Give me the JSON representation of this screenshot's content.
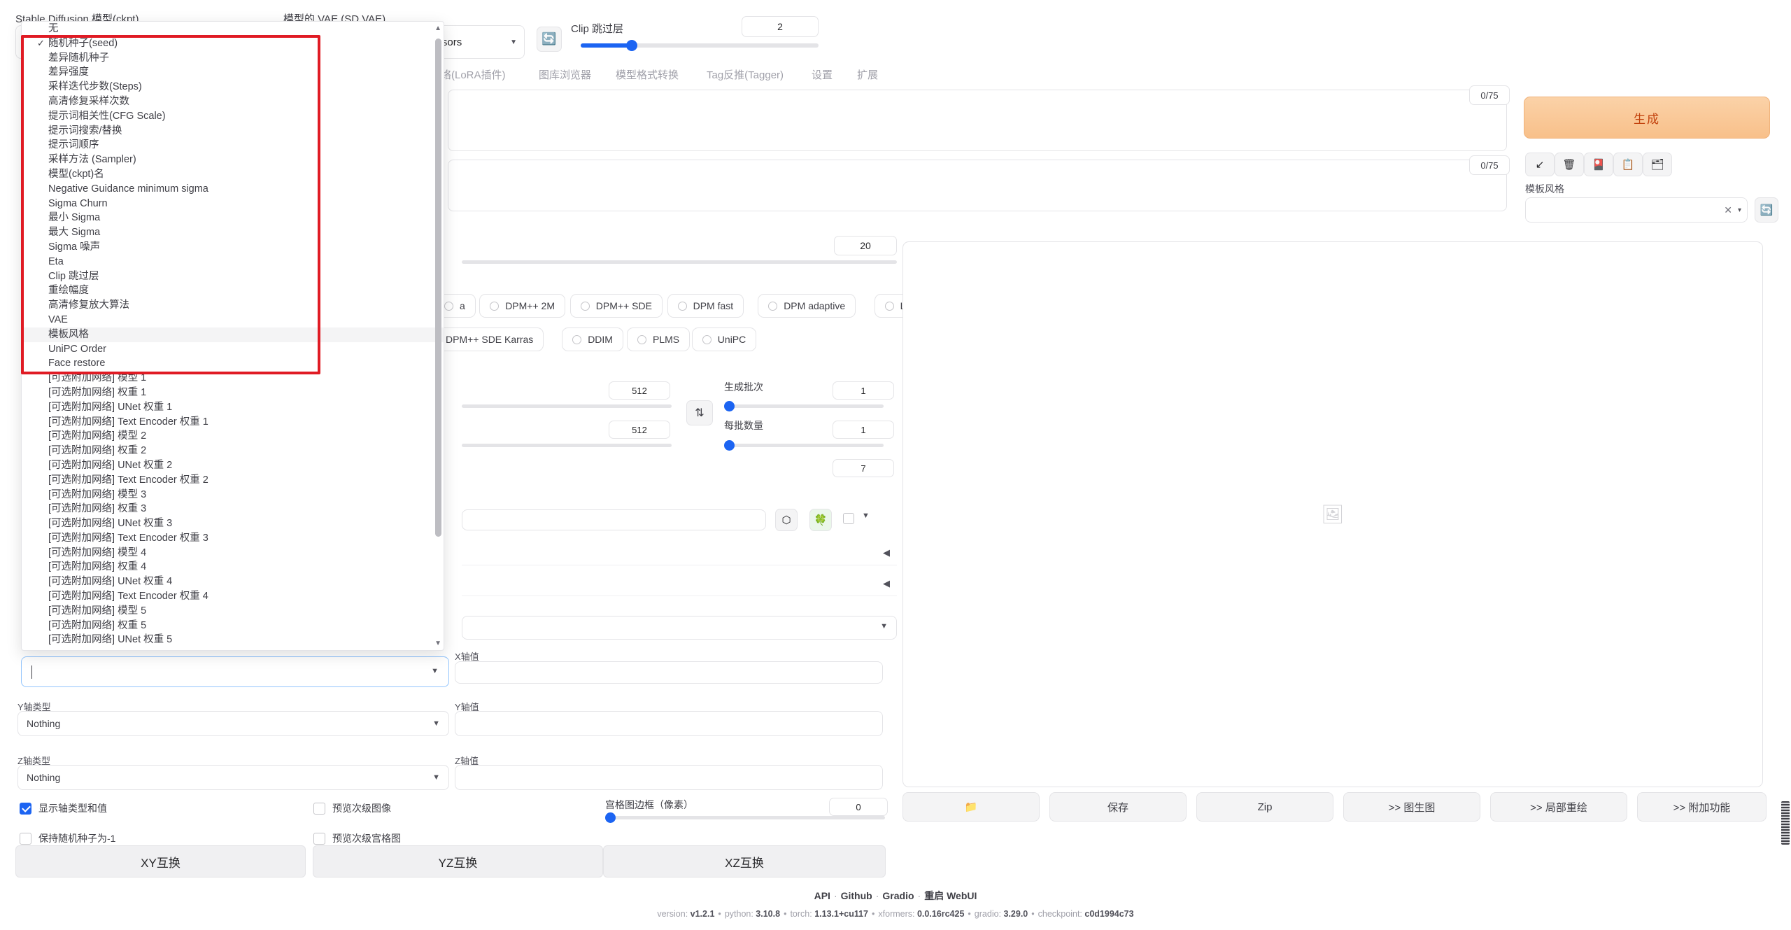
{
  "topbar": {
    "ckpt_label": "Stable Diffusion 模型(ckpt)",
    "vae_label": "模型的 VAE (SD VAE)",
    "tensors_value": "tensors",
    "refresh_icon": "refresh-icon",
    "clip_skip_label": "Clip 跳过层",
    "clip_skip_value": "2"
  },
  "tabs": [
    "络(LoRA插件)",
    "图库浏览器",
    "模型格式转换",
    "Tag反推(Tagger)",
    "设置",
    "扩展"
  ],
  "prompts": {
    "positive_counter": "0/75",
    "negative_counter": "0/75"
  },
  "right_panel": {
    "generate_label": "生成",
    "tool_buttons": [
      {
        "name": "arrow-down-left-icon",
        "glyph": "↙"
      },
      {
        "name": "trash-icon",
        "glyph": "🗑"
      },
      {
        "name": "red-card-icon",
        "glyph": "🎴"
      },
      {
        "name": "clipboard-icon",
        "glyph": "📋"
      },
      {
        "name": "save-style-icon",
        "glyph": "🗂"
      }
    ],
    "style_label": "模板风格",
    "style_value": "",
    "style_clear_glyph": "✕",
    "style_caret_glyph": "▾",
    "style_refresh_glyph": "🔄"
  },
  "settings": {
    "steps_value": "20",
    "samplers_row1": [
      "a",
      "DPM++ 2M",
      "DPM++ SDE",
      "DPM fast",
      "DPM adaptive",
      "LMS Karras"
    ],
    "samplers_row2": [
      "DPM++ SDE Karras",
      "DDIM",
      "PLMS",
      "UniPC"
    ],
    "width_value": "512",
    "height_value": "512",
    "swap_glyph": "⇅",
    "batch_count_label": "生成批次",
    "batch_count_value": "1",
    "batch_size_label": "每批数量",
    "batch_size_value": "1",
    "cfg_value": "7",
    "mini_buttons": [
      {
        "name": "cube-icon",
        "glyph": "⬡"
      },
      {
        "name": "leaf-icon",
        "glyph": "🍀"
      }
    ]
  },
  "gallery": {
    "placeholder_icon": "image-placeholder-icon"
  },
  "gallery_buttons": [
    {
      "name": "open-folder-button",
      "label": "📁"
    },
    {
      "name": "save-button",
      "label": "保存"
    },
    {
      "name": "zip-button",
      "label": "Zip"
    },
    {
      "name": "send-to-img2img-button",
      "label": ">> 图生图"
    },
    {
      "name": "send-to-inpaint-button",
      "label": ">> 局部重绘"
    },
    {
      "name": "send-to-extras-button",
      "label": ">> 附加功能"
    }
  ],
  "xyz": {
    "x_value_label": "X轴值",
    "x_value": "",
    "y_type_label": "Y轴类型",
    "y_type_value": "Nothing",
    "y_value_label": "Y轴值",
    "y_value": "",
    "z_type_label": "Z轴类型",
    "z_type_value": "Nothing",
    "z_value_label": "Z轴值",
    "z_value": "",
    "checkboxes": [
      {
        "name": "show-axis-types-and-values",
        "label": "显示轴类型和值",
        "checked": true
      },
      {
        "name": "preview-sub-images",
        "label": "预览次级图像",
        "checked": false
      },
      {
        "name": "keep-seed-minus-one",
        "label": "保持随机种子为-1",
        "checked": false
      },
      {
        "name": "preview-sub-grid",
        "label": "预览次级宫格图",
        "checked": false
      }
    ],
    "grid_margin_label": "宫格图边框（像素）",
    "grid_margin_value": "0",
    "swap_buttons": [
      "XY互换",
      "YZ互换",
      "XZ互换"
    ]
  },
  "dropdown": {
    "scroll_up_glyph": "▲",
    "scroll_down_glyph": "▼",
    "selected_check": "✓",
    "items": [
      {
        "label": "无",
        "checked": false,
        "highlight": false
      },
      {
        "label": "随机种子(seed)",
        "checked": true,
        "highlight": false
      },
      {
        "label": "差异随机种子",
        "checked": false,
        "highlight": false
      },
      {
        "label": "差异强度",
        "checked": false,
        "highlight": false
      },
      {
        "label": "采样迭代步数(Steps)",
        "checked": false,
        "highlight": false
      },
      {
        "label": "高清修复采样次数",
        "checked": false,
        "highlight": false
      },
      {
        "label": "提示词相关性(CFG Scale)",
        "checked": false,
        "highlight": false
      },
      {
        "label": "提示词搜索/替换",
        "checked": false,
        "highlight": false
      },
      {
        "label": "提示词顺序",
        "checked": false,
        "highlight": false
      },
      {
        "label": "采样方法 (Sampler)",
        "checked": false,
        "highlight": false
      },
      {
        "label": "模型(ckpt)名",
        "checked": false,
        "highlight": false
      },
      {
        "label": "Negative Guidance minimum sigma",
        "checked": false,
        "highlight": false
      },
      {
        "label": "Sigma Churn",
        "checked": false,
        "highlight": false
      },
      {
        "label": "最小 Sigma",
        "checked": false,
        "highlight": false
      },
      {
        "label": "最大 Sigma",
        "checked": false,
        "highlight": false
      },
      {
        "label": "Sigma 噪声",
        "checked": false,
        "highlight": false
      },
      {
        "label": "Eta",
        "checked": false,
        "highlight": false
      },
      {
        "label": "Clip 跳过层",
        "checked": false,
        "highlight": false
      },
      {
        "label": "重绘幅度",
        "checked": false,
        "highlight": false
      },
      {
        "label": "高清修复放大算法",
        "checked": false,
        "highlight": false
      },
      {
        "label": "VAE",
        "checked": false,
        "highlight": false
      },
      {
        "label": "模板风格",
        "checked": false,
        "highlight": true
      },
      {
        "label": "UniPC Order",
        "checked": false,
        "highlight": false
      },
      {
        "label": "Face restore",
        "checked": false,
        "highlight": false
      },
      {
        "label": "[可选附加网络] 模型 1",
        "checked": false,
        "highlight": false
      },
      {
        "label": "[可选附加网络] 权重 1",
        "checked": false,
        "highlight": false
      },
      {
        "label": "[可选附加网络] UNet 权重 1",
        "checked": false,
        "highlight": false
      },
      {
        "label": "[可选附加网络] Text Encoder 权重 1",
        "checked": false,
        "highlight": false
      },
      {
        "label": "[可选附加网络] 模型 2",
        "checked": false,
        "highlight": false
      },
      {
        "label": "[可选附加网络] 权重 2",
        "checked": false,
        "highlight": false
      },
      {
        "label": "[可选附加网络] UNet 权重 2",
        "checked": false,
        "highlight": false
      },
      {
        "label": "[可选附加网络] Text Encoder 权重 2",
        "checked": false,
        "highlight": false
      },
      {
        "label": "[可选附加网络] 模型 3",
        "checked": false,
        "highlight": false
      },
      {
        "label": "[可选附加网络] 权重 3",
        "checked": false,
        "highlight": false
      },
      {
        "label": "[可选附加网络] UNet 权重 3",
        "checked": false,
        "highlight": false
      },
      {
        "label": "[可选附加网络] Text Encoder 权重 3",
        "checked": false,
        "highlight": false
      },
      {
        "label": "[可选附加网络] 模型 4",
        "checked": false,
        "highlight": false
      },
      {
        "label": "[可选附加网络] 权重 4",
        "checked": false,
        "highlight": false
      },
      {
        "label": "[可选附加网络] UNet 权重 4",
        "checked": false,
        "highlight": false
      },
      {
        "label": "[可选附加网络] Text Encoder 权重 4",
        "checked": false,
        "highlight": false
      },
      {
        "label": "[可选附加网络] 模型 5",
        "checked": false,
        "highlight": false
      },
      {
        "label": "[可选附加网络] 权重 5",
        "checked": false,
        "highlight": false
      },
      {
        "label": "[可选附加网络] UNet 权重 5",
        "checked": false,
        "highlight": false
      }
    ]
  },
  "footer": {
    "links": [
      "API",
      "Github",
      "Gradio",
      "重启 WebUI"
    ],
    "meta": [
      {
        "key": "version:",
        "value": "v1.2.1"
      },
      {
        "key": "python:",
        "value": "3.10.8"
      },
      {
        "key": "torch:",
        "value": "1.13.1+cu117"
      },
      {
        "key": "xformers:",
        "value": "0.0.16rc425"
      },
      {
        "key": "gradio:",
        "value": "3.29.0"
      },
      {
        "key": "checkpoint:",
        "value": "c0d1994c73"
      }
    ]
  },
  "colors": {
    "accent_blue": "#1c64f2",
    "generate_orange": "#f8c08a",
    "redbox": "#e01b24"
  }
}
